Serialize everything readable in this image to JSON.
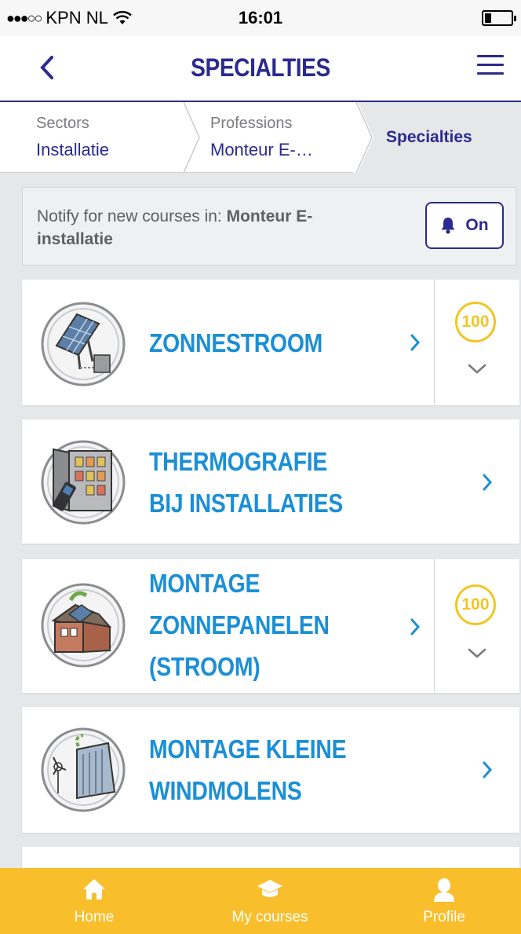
{
  "status_bar": {
    "carrier": "KPN NL",
    "time": "16:01"
  },
  "header": {
    "title": "SPECIALTIES"
  },
  "breadcrumb": {
    "items": [
      {
        "label": "Sectors",
        "value": "Installatie"
      },
      {
        "label": "Professions",
        "value": "Monteur E-…"
      }
    ],
    "current": "Specialties"
  },
  "notify": {
    "prefix": "Notify for new courses in: ",
    "profession": "Monteur E-installatie",
    "toggle_label": "On"
  },
  "courses": [
    {
      "title": "ZONNESTROOM",
      "score": "100",
      "icon": "solar-panel-icon"
    },
    {
      "title": "THERMOGRAFIE BIJ INSTALLATIES",
      "icon": "thermography-icon"
    },
    {
      "title": "MONTAGE ZONNEPANELEN (STROOM)",
      "score": "100",
      "icon": "house-solar-icon"
    },
    {
      "title": "MONTAGE KLEINE WINDMOLENS",
      "icon": "wind-turbine-icon"
    }
  ],
  "tabbar": [
    {
      "label": "Home",
      "icon": "home-icon"
    },
    {
      "label": "My courses",
      "icon": "graduation-cap-icon"
    },
    {
      "label": "Profile",
      "icon": "user-icon"
    }
  ],
  "colors": {
    "primary": "#2b2a8f",
    "course_title": "#1b8fd6",
    "score": "#f2c623",
    "tabbar": "#f8be2c"
  }
}
